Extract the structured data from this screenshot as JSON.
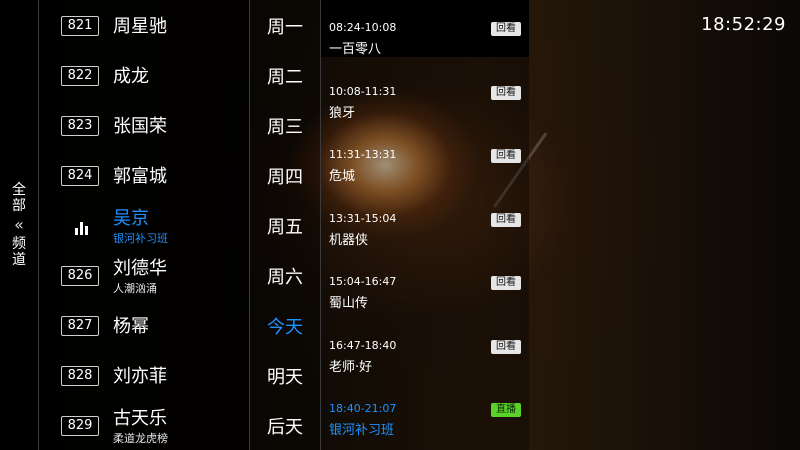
{
  "side_tab": {
    "top_chars": [
      "全",
      "部"
    ],
    "chevron": "«",
    "bottom_chars": [
      "频",
      "道"
    ]
  },
  "channels": [
    {
      "number": "821",
      "name": "周星驰",
      "subtitle": ""
    },
    {
      "number": "822",
      "name": "成龙",
      "subtitle": ""
    },
    {
      "number": "823",
      "name": "张国荣",
      "subtitle": ""
    },
    {
      "number": "824",
      "name": "郭富城",
      "subtitle": ""
    },
    {
      "number": "",
      "name": "吴京",
      "subtitle": "银河补习班",
      "playing": true
    },
    {
      "number": "826",
      "name": "刘德华",
      "subtitle": "人潮汹涌"
    },
    {
      "number": "827",
      "name": "杨幂",
      "subtitle": ""
    },
    {
      "number": "828",
      "name": "刘亦菲",
      "subtitle": ""
    },
    {
      "number": "829",
      "name": "古天乐",
      "subtitle": "柔道龙虎榜"
    }
  ],
  "days": [
    "周一",
    "周二",
    "周三",
    "周四",
    "周五",
    "周六",
    "今天",
    "明天",
    "后天"
  ],
  "selected_day_index": 6,
  "programs": [
    {
      "time": "08:24-10:08",
      "title": "一百零八",
      "badge": "回看"
    },
    {
      "time": "10:08-11:31",
      "title": "狼牙",
      "badge": "回看"
    },
    {
      "time": "11:31-13:31",
      "title": "危城",
      "badge": "回看"
    },
    {
      "time": "13:31-15:04",
      "title": "机器侠",
      "badge": "回看"
    },
    {
      "time": "15:04-16:47",
      "title": "蜀山传",
      "badge": "回看"
    },
    {
      "time": "16:47-18:40",
      "title": "老师·好",
      "badge": "回看"
    },
    {
      "time": "18:40-21:07",
      "title": "银河补习班",
      "badge": "直播",
      "live": true
    }
  ],
  "clock": "18:52:29",
  "colors": {
    "accent": "#1e90ff",
    "live_badge": "#5ad12a",
    "replay_badge": "#e6e6e6"
  }
}
